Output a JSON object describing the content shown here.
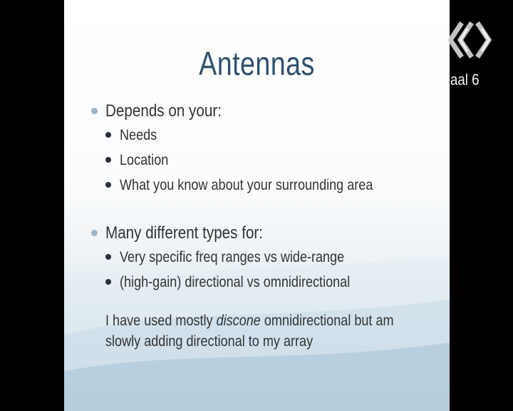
{
  "slide": {
    "title": "Antennas",
    "sections": [
      {
        "heading": "Depends on your:",
        "items": [
          "Needs",
          "Location",
          "What you know about your surrounding area"
        ]
      },
      {
        "heading": "Many different types for:",
        "items": [
          "Very specific freq ranges vs wide-range",
          "(high-gain) directional vs omnidirectional"
        ]
      }
    ],
    "note": {
      "line1_before": "I have used mostly ",
      "line1_italic": "discone",
      "line1_after": " omnidirectional but am",
      "line2": "slowly adding directional to my array"
    }
  },
  "overlay": {
    "channel_text": "aal 6",
    "logo_icon": "channel-logo-icon"
  },
  "colors": {
    "title": "#2f4f6e",
    "body_text": "#333333",
    "level1_bullet": "#9fb5c8",
    "level2_bullet": "#2a2f38",
    "background_frame": "#000000"
  }
}
